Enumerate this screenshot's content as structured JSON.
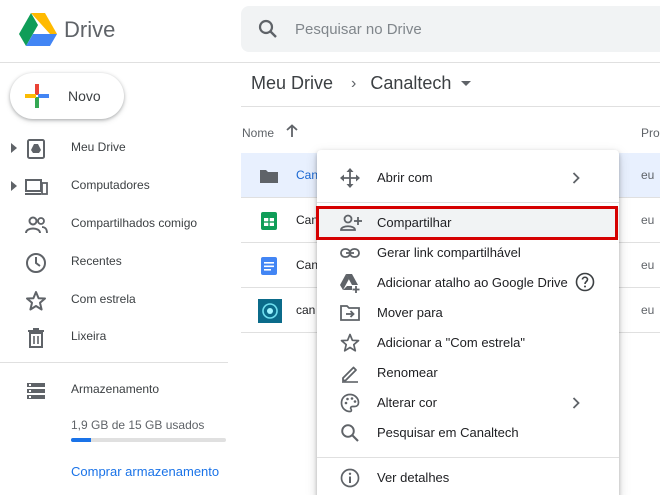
{
  "app": {
    "title": "Drive"
  },
  "search": {
    "placeholder": "Pesquisar no Drive"
  },
  "new_button": {
    "label": "Novo"
  },
  "sidebar": {
    "items": [
      {
        "label": "Meu Drive",
        "icon": "my-drive-icon"
      },
      {
        "label": "Computadores",
        "icon": "computers-icon"
      },
      {
        "label": "Compartilhados comigo",
        "icon": "shared-icon"
      },
      {
        "label": "Recentes",
        "icon": "clock-icon"
      },
      {
        "label": "Com estrela",
        "icon": "star-icon"
      },
      {
        "label": "Lixeira",
        "icon": "trash-icon"
      },
      {
        "label": "Armazenamento",
        "icon": "storage-icon"
      }
    ],
    "storage": {
      "text": "1,9 GB de 15 GB usados",
      "used_fraction": 0.127
    },
    "buy_link": "Comprar armazenamento"
  },
  "breadcrumb": {
    "root": "Meu Drive",
    "current": "Canaltech"
  },
  "list": {
    "col_name": "Nome",
    "col_owner": "Pro",
    "rows": [
      {
        "name": "Can",
        "owner": "eu",
        "type": "folder-icon"
      },
      {
        "name": "Can",
        "owner": "eu",
        "type": "sheets-icon"
      },
      {
        "name": "Can",
        "owner": "eu",
        "type": "docs-icon"
      },
      {
        "name": "can",
        "owner": "eu",
        "type": "image-thumb-icon"
      }
    ]
  },
  "context_menu": {
    "items": [
      {
        "label": "Abrir com",
        "icon": "move-arrows-icon"
      },
      {
        "label": "Compartilhar",
        "icon": "add-person-icon"
      },
      {
        "label": "Gerar link compartilhável",
        "icon": "link-icon"
      },
      {
        "label": "Adicionar atalho ao Google Drive",
        "icon": "drive-shortcut-icon"
      },
      {
        "label": "Mover para",
        "icon": "move-to-icon"
      },
      {
        "label": "Adicionar a \"Com estrela\"",
        "icon": "star-outline-icon"
      },
      {
        "label": "Renomear",
        "icon": "pencil-icon"
      },
      {
        "label": "Alterar cor",
        "icon": "palette-icon"
      },
      {
        "label": "Pesquisar em Canaltech",
        "icon": "search-icon"
      },
      {
        "label": "Ver detalhes",
        "icon": "info-icon"
      }
    ]
  },
  "colors": {
    "accent": "#1a73e8",
    "highlight_border": "#d50000",
    "selected_row": "#e8f0fe"
  }
}
